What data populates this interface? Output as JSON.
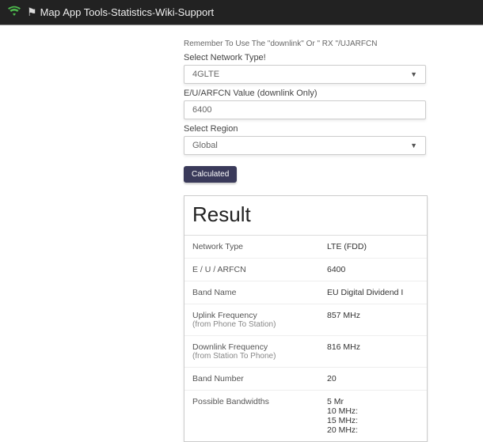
{
  "nav": {
    "items": [
      "Map",
      "App",
      "Tools",
      "Statistics",
      "Wiki",
      "Support"
    ]
  },
  "form": {
    "hint": "Remember To Use The \"downlink\" Or \" RX \"/UJARFCN",
    "network_label": "Select Network Type!",
    "network_value": "4GLTE",
    "arfcn_label": "E/U/ARFCN Value (downlink Only)",
    "arfcn_value": "6400",
    "region_label": "Select Region",
    "region_value": "Global",
    "calculate_btn": "Calculated"
  },
  "results": {
    "title": "Result",
    "rows": [
      {
        "label": "Network Type",
        "sub": "",
        "value": "LTE (FDD)"
      },
      {
        "label": "E / U / ARFCN",
        "sub": "",
        "value": "6400"
      },
      {
        "label": "Band Name",
        "sub": "",
        "value": "EU Digital Dividend I"
      },
      {
        "label": "Uplink Frequency",
        "sub": "(from Phone To Station)",
        "value": "857 MHz"
      },
      {
        "label": "Downlink Frequency",
        "sub": "(from Station To Phone)",
        "value": "816 MHz"
      },
      {
        "label": "Band Number",
        "sub": "",
        "value": "20"
      },
      {
        "label": "Possible Bandwidths",
        "sub": "",
        "value": "5 Mr\n10 MHz:\n15 MHz:\n20 MHz:"
      }
    ]
  }
}
